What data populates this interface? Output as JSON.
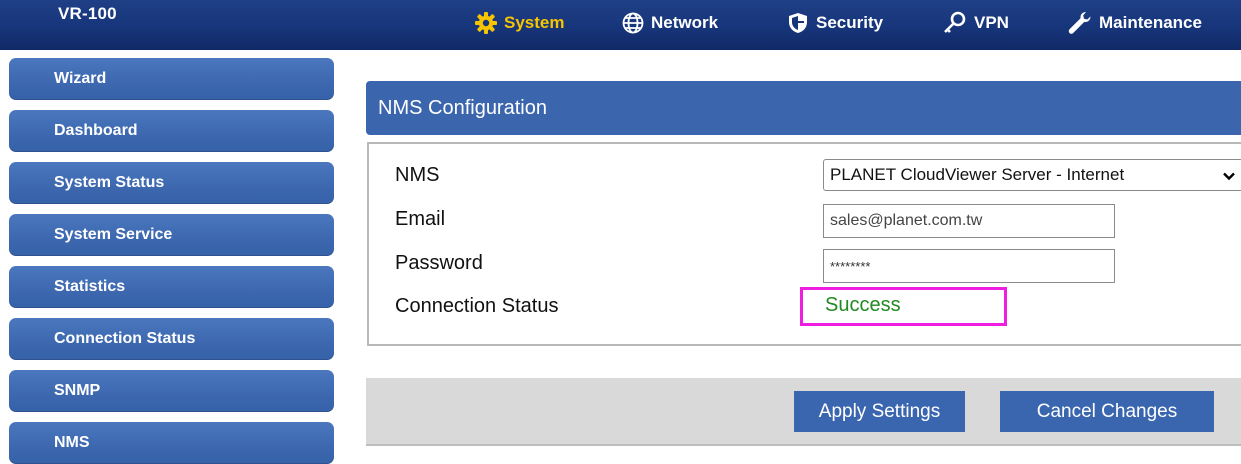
{
  "header": {
    "brand": "VR-100",
    "nav": [
      {
        "label": "System",
        "icon": "gear-icon",
        "active": true
      },
      {
        "label": "Network",
        "icon": "globe-icon"
      },
      {
        "label": "Security",
        "icon": "shield-icon"
      },
      {
        "label": "VPN",
        "icon": "key-icon"
      },
      {
        "label": "Maintenance",
        "icon": "wrench-icon"
      }
    ],
    "colors": {
      "bar": "#17357a",
      "active": "#f7c400"
    }
  },
  "sidebar": {
    "items": [
      {
        "label": "Wizard"
      },
      {
        "label": "Dashboard"
      },
      {
        "label": "System Status"
      },
      {
        "label": "System Service"
      },
      {
        "label": "Statistics"
      },
      {
        "label": "Connection Status"
      },
      {
        "label": "SNMP"
      },
      {
        "label": "NMS"
      }
    ]
  },
  "panel": {
    "title": "NMS Configuration",
    "fields": {
      "nms_label": "NMS",
      "nms_value": "PLANET CloudViewer Server - Internet",
      "email_label": "Email",
      "email_value": "sales@planet.com.tw",
      "password_label": "Password",
      "password_value": "********",
      "status_label": "Connection Status",
      "status_value": "Success"
    },
    "colors": {
      "header": "#3b66ae",
      "status_ok": "#218a21",
      "highlight": "#ee1de0"
    }
  },
  "actions": {
    "apply": "Apply Settings",
    "cancel": "Cancel Changes"
  }
}
